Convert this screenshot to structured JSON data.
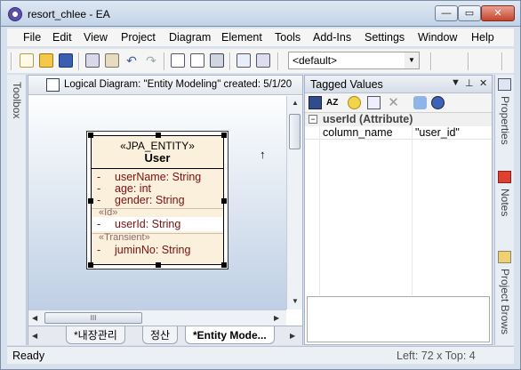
{
  "window": {
    "title": "resort_chlee - EA",
    "controls": {
      "min": "—",
      "max": "▭",
      "close": "✕"
    }
  },
  "menu": {
    "items": [
      "File",
      "Edit",
      "View",
      "Project",
      "Diagram",
      "Element",
      "Tools",
      "Add-Ins",
      "Settings",
      "Window",
      "Help"
    ]
  },
  "toolbar": {
    "combo_value": "<default>",
    "combo_arrow": "▼"
  },
  "toolbox": {
    "label": "Toolbox"
  },
  "diagram": {
    "title": "Logical Diagram: \"Entity Modeling\"  created: 5/1/20",
    "tabs": [
      "*내장관리",
      "정산",
      "*Entity Mode..."
    ],
    "hscroll_grip": "III",
    "nav_left": "◀",
    "nav_right": "▶"
  },
  "entity": {
    "stereotype": "«JPA_ENTITY»",
    "name": "User",
    "attributes": [
      {
        "dash": "-",
        "text": "userName:  String"
      },
      {
        "dash": "-",
        "text": "age:  int"
      },
      {
        "dash": "-",
        "text": "gender:  String"
      }
    ],
    "id_label": "«Id»",
    "id_attr": {
      "dash": "-",
      "text": "userId:  String"
    },
    "transient_label": "«Transient»",
    "transient_attr": {
      "dash": "-",
      "text": "juminNo:  String"
    }
  },
  "tagged_values": {
    "title": "Tagged Values",
    "header_glyphs": [
      "▼",
      "⊥",
      "✕"
    ],
    "group_toggle": "−",
    "group_label": "userId (Attribute)",
    "rows": [
      {
        "key": "column_name",
        "value": "\"user_id\""
      }
    ]
  },
  "right_strip": {
    "tabs": [
      "Properties",
      "Notes",
      "Project Brows"
    ]
  },
  "status": {
    "left": "Ready",
    "right": "Left:   72 x Top:   4"
  },
  "colors": {
    "entity_fill": "#fbf0dc",
    "attr_text": "#7a1010",
    "title_gradient": "#c3d3e7"
  }
}
